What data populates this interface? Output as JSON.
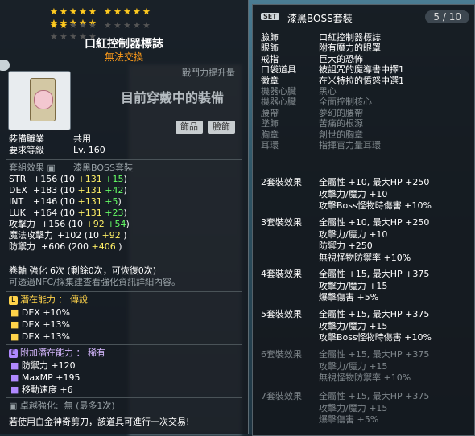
{
  "stars": {
    "filled": 17,
    "total": 25
  },
  "item": {
    "name": "口紅控制器標誌",
    "trade_note": "無法交換",
    "combat_power_label": "戰鬥力提升量",
    "equipped_status": "目前穿戴中的裝備",
    "slot_buttons": [
      "飾品",
      "臉飾"
    ],
    "job_label": "裝備職業",
    "job_value": "共用",
    "level_label": "要求等級",
    "level_value": "Lv. 160",
    "set_label": "套組效果",
    "set_value": "漆黑BOSS套裝",
    "stats": [
      {
        "name": "STR",
        "total": "+156",
        "base": "10",
        "upgrade": "+131",
        "extra": "+15"
      },
      {
        "name": "DEX",
        "total": "+183",
        "base": "10",
        "upgrade": "+131",
        "extra": "+42"
      },
      {
        "name": "INT",
        "total": "+146",
        "base": "10",
        "upgrade": "+131",
        "extra": "+5"
      },
      {
        "name": "LUK",
        "total": "+164",
        "base": "10",
        "upgrade": "+131",
        "extra": "+23"
      },
      {
        "name": "攻擊力",
        "total": "+156",
        "base": "10",
        "upgrade": "+92",
        "extra": "+54"
      },
      {
        "name": "魔法攻擊力",
        "total": "+102",
        "base": "10",
        "upgrade": "+92",
        "extra": ""
      },
      {
        "name": "防禦力",
        "total": "+606",
        "base": "200",
        "upgrade": "+406",
        "extra": ""
      }
    ],
    "scroll_line": "卷軸 強化 6次 (剩餘0次，可恢復0次)",
    "nfc_note": "可透過NFC/採集建查看強化資訊詳細內容。",
    "potential_title": "潛在能力 ： 傳說",
    "potential_lines": [
      "DEX +10%",
      "DEX +13%",
      "DEX +13%"
    ],
    "bonus_title": "附加潛在能力 ： 稀有",
    "bonus_lines": [
      "防禦力 +120",
      "MaxMP +195",
      "移動速度 +6"
    ],
    "soul_line": "卓越強化:  無 (最多1次)",
    "bottom_note": "若使用白金神奇剪刀，該道具可進行一次交易!",
    "colors": {
      "legend": "#ffd34a",
      "rare": "#b089ff",
      "upgrade": "#fff066",
      "extra": "#66ff66"
    }
  },
  "set_panel": {
    "badge": "SET",
    "name": "漆黑BOSS套裝",
    "count": "5 / 10",
    "pieces": [
      {
        "slot": "臉飾",
        "name": "口紅控制器標誌",
        "on": true
      },
      {
        "slot": "眼飾",
        "name": "附有魔力的眼罩",
        "on": true
      },
      {
        "slot": "戒指",
        "name": "巨大的恐怖",
        "on": true
      },
      {
        "slot": "口袋道具",
        "name": "被詛咒的魔導書中擇1",
        "on": true
      },
      {
        "slot": "徽章",
        "name": "在米特拉的憤怒中選1",
        "on": true
      },
      {
        "slot": "機器心臟",
        "name": "黑心",
        "on": false
      },
      {
        "slot": "機器心臟",
        "name": "全面控制核心",
        "on": false
      },
      {
        "slot": "腰帶",
        "name": "夢幻的腰帶",
        "on": false
      },
      {
        "slot": "墜飾",
        "name": "苦痛的根源",
        "on": false
      },
      {
        "slot": "胸章",
        "name": "創世的胸章",
        "on": false
      },
      {
        "slot": "耳環",
        "name": "指揮官力量耳環",
        "on": false
      }
    ],
    "effects": [
      {
        "title": "2套裝效果",
        "on": true,
        "lines": [
          "全屬性 +10, 最大HP +250",
          "攻擊力/魔力 +10",
          "攻擊Boss怪物時傷害 +10%"
        ]
      },
      {
        "title": "3套裝效果",
        "on": true,
        "lines": [
          "全屬性 +10, 最大HP +250",
          "攻擊力/魔力 +10",
          "防禦力 +250",
          "無視怪物防禦率 +10%"
        ]
      },
      {
        "title": "4套裝效果",
        "on": true,
        "lines": [
          "全屬性 +15, 最大HP +375",
          "攻擊力/魔力 +15",
          "爆擊傷害 +5%"
        ]
      },
      {
        "title": "5套裝效果",
        "on": true,
        "lines": [
          "全屬性 +15, 最大HP +375",
          "攻擊力/魔力 +15",
          "攻擊Boss怪物時傷害 +10%"
        ]
      },
      {
        "title": "6套裝效果",
        "on": false,
        "lines": [
          "全屬性 +15, 最大HP +375",
          "攻擊力/魔力 +15",
          "無視怪物防禦率 +10%"
        ]
      },
      {
        "title": "7套裝效果",
        "on": false,
        "lines": [
          "全屬性 +15, 最大HP +375",
          "攻擊力/魔力 +15",
          "爆擊傷害 +5%"
        ]
      }
    ]
  }
}
